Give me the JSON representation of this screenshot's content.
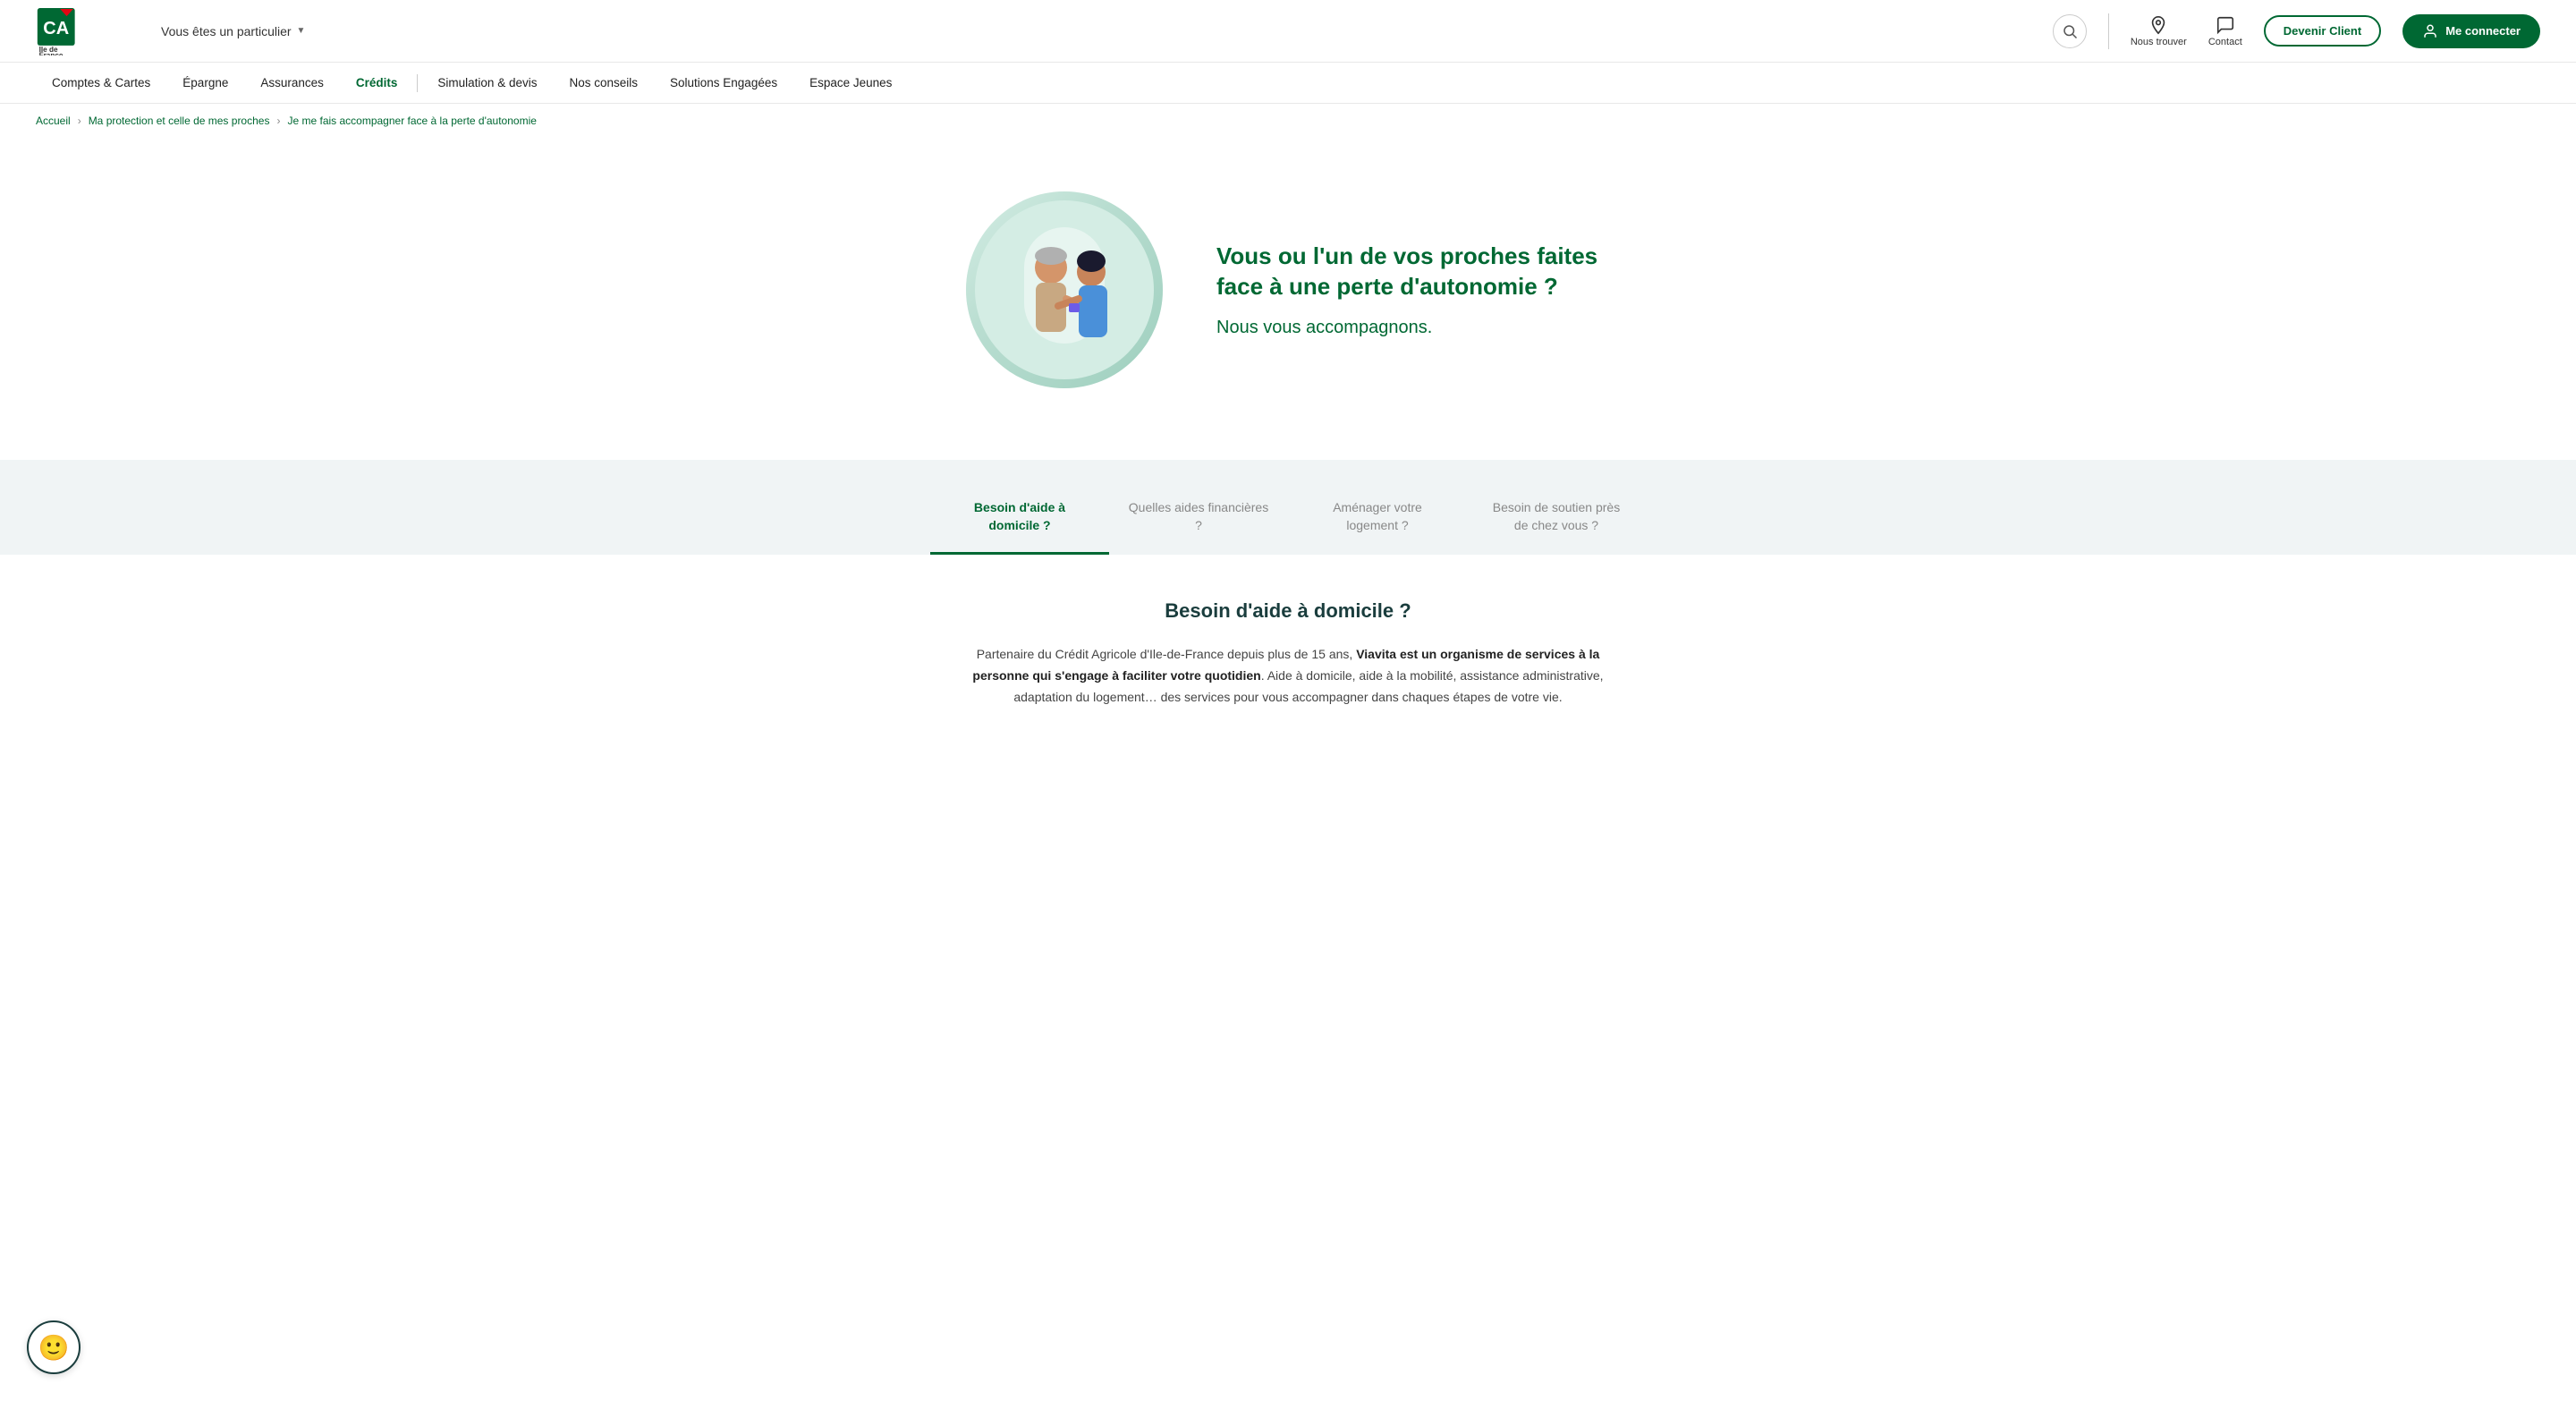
{
  "header": {
    "user_selector": "Vous êtes un particulier",
    "search_label": "Rechercher",
    "find_us_label": "Nous trouver",
    "contact_label": "Contact",
    "devenir_client_label": "Devenir Client",
    "me_connecter_label": "Me connecter"
  },
  "nav": {
    "items": [
      {
        "label": "Comptes & Cartes",
        "active": false
      },
      {
        "label": "Épargne",
        "active": false
      },
      {
        "label": "Assurances",
        "active": false
      },
      {
        "label": "Crédits",
        "active": true
      },
      {
        "label": "Simulation & devis",
        "active": false
      },
      {
        "label": "Nos conseils",
        "active": false
      },
      {
        "label": "Solutions Engagées",
        "active": false
      },
      {
        "label": "Espace Jeunes",
        "active": false
      }
    ]
  },
  "breadcrumb": {
    "home": "Accueil",
    "parent": "Ma protection et celle de mes proches",
    "current": "Je me fais accompagner face à la perte d'autonomie"
  },
  "hero": {
    "title": "Vous ou l'un de vos proches faites face à une perte d'autonomie ?",
    "subtitle": "Nous vous accompagnons."
  },
  "tabs": [
    {
      "label": "Besoin d'aide à domicile ?",
      "active": true
    },
    {
      "label": "Quelles aides financières ?",
      "active": false
    },
    {
      "label": "Aménager votre logement ?",
      "active": false
    },
    {
      "label": "Besoin de soutien près de chez vous ?",
      "active": false
    }
  ],
  "content": {
    "title": "Besoin d'aide à domicile ?",
    "text_part1": "Partenaire du Crédit Agricole d'Ile-de-France depuis plus de 15 ans, ",
    "text_bold": "Viavita est un organisme de services à la personne qui s'engage à faciliter votre quotidien",
    "text_part2": ". Aide à domicile, aide à la mobilité, assistance administrative, adaptation du logement… des services pour vous accompagner dans chaques étapes de votre vie."
  },
  "chatbot": {
    "icon": "🙂"
  },
  "colors": {
    "primary_green": "#006833",
    "dark_green": "#1a3d3d",
    "light_bg": "#f0f4f5"
  }
}
